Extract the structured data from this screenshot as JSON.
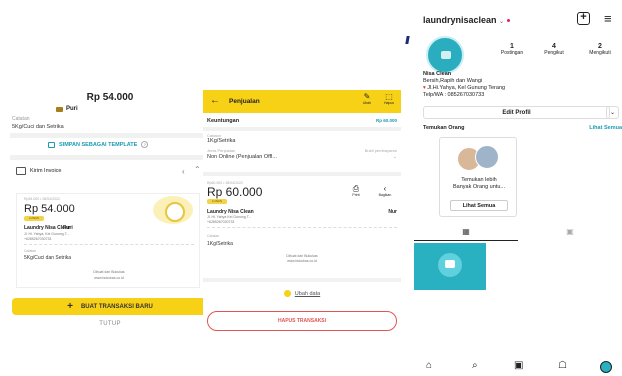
{
  "panel1": {
    "total": "Rp 54.000",
    "customer": "Puri",
    "note_label": "Catatan",
    "note_value": "5Kg/Cuci dan Setrika",
    "save_template": "SIMPAN SEBAGAI TEMPLATE",
    "send_invoice": "Kirim Invoice",
    "receipt": {
      "meta": "Rp54.000 • 28/04/2022",
      "amount": "Rp 54.000",
      "status": "LUNAS",
      "shop": "Laundry Nisa Clean",
      "customer": "Puri",
      "address": "Jl. Hi. Yahya, Kel Gunung T...",
      "phone": "+6285267030733",
      "note_label": "Catatan",
      "note_value": "5Kg/Cuci dan Setrika",
      "footer1": "Dibuat dari Bukukas",
      "footer2": "www.bukukas.co.id"
    },
    "new_transaction": "BUAT TRANSAKSI BARU",
    "close": "TUTUP"
  },
  "panel2": {
    "title": "Penjualan",
    "edit": "Ubah",
    "delete": "Hapus",
    "profit_label": "Keuntungan",
    "profit_value": "Rp 60.000",
    "note_label": "Catatan",
    "note_value": "1Kg/Setrika",
    "sales_type_label": "Jenis Penjualan",
    "sales_type_value": "Non Online (Penjualan Offl...",
    "payment_proof_label": "Bukti pembayaran",
    "receipt": {
      "meta": "Rp60.000 • 28/04/2022",
      "amount": "Rp 60.000",
      "status": "LUNAS",
      "shop": "Laundry Nisa Clean",
      "customer": "Nur",
      "address": "Jl. Hi. Yahya Kel Gunung T...",
      "phone": "+6285267030733",
      "note_label": "Catatan",
      "note_value": "1Kg/Setrika",
      "footer1": "Dibuat dari Bukukas",
      "footer2": "www.bukukas.co.id"
    },
    "print": "Print",
    "share": "Bagikan",
    "edit_data": "Ubah data",
    "delete_transaction": "HAPUS TRANSAKSI"
  },
  "panel3": {
    "username": "laundrynisaclean",
    "stats": [
      {
        "value": "1",
        "label": "Postingan"
      },
      {
        "value": "4",
        "label": "Pengikut"
      },
      {
        "value": "2",
        "label": "Mengikuti"
      }
    ],
    "bio": [
      "Nisa Clean",
      "Bersih,Rapih dan Wangi",
      "Jl.Hi.Yahya, Kel Gunung Terang",
      "Telp/WA : 085267030733"
    ],
    "edit_profile": "Edit Profil",
    "discover_people": "Temukan Orang",
    "see_all": "Lihat Semua",
    "card_line1": "Temukan lebih",
    "card_line2": "Banyak Orang untu...",
    "card_button": "Lihat Semua"
  },
  "colors": {
    "accent_yellow": "#f7d116",
    "accent_teal": "#1a9bb5",
    "danger": "#e25555"
  }
}
